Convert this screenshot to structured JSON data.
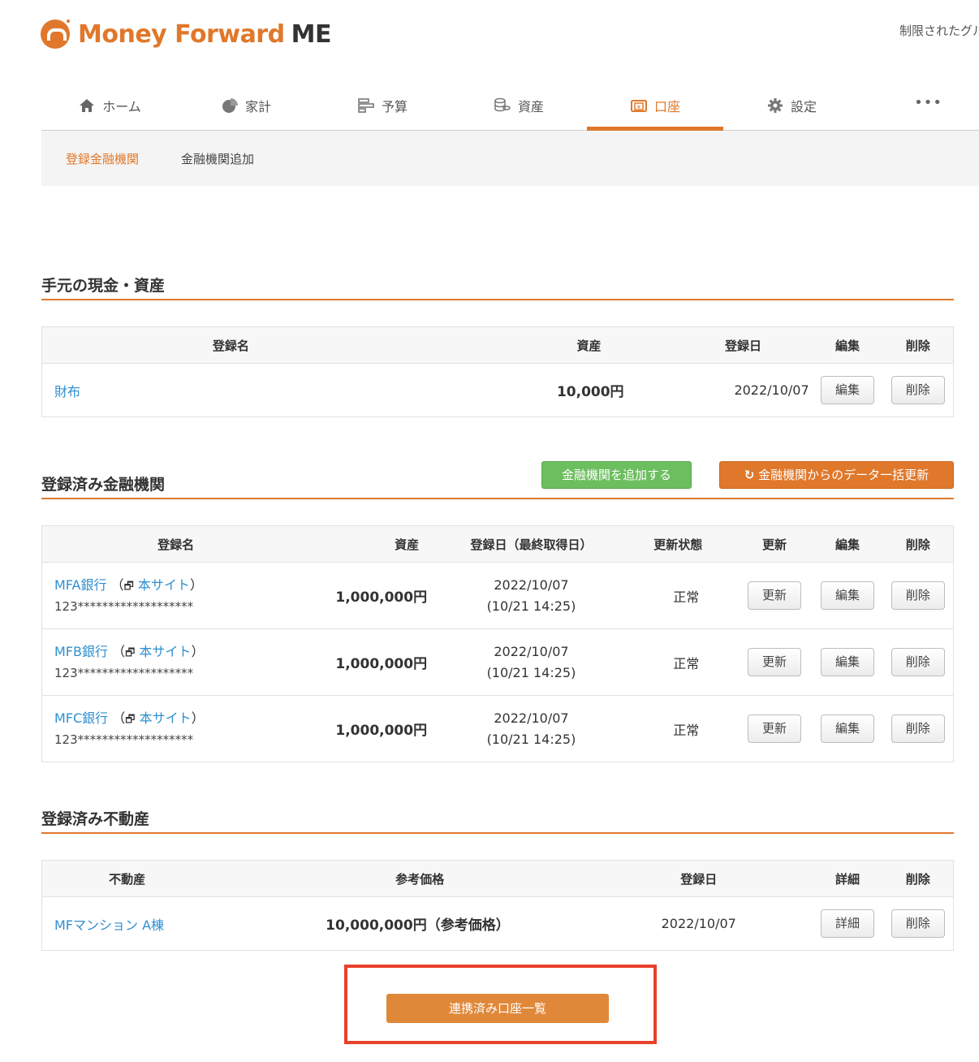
{
  "header": {
    "brand": "Money Forward",
    "brand_suffix": "ME",
    "user_text": "制限されたグル"
  },
  "nav": {
    "items": [
      {
        "label": "ホーム",
        "icon": "home-icon"
      },
      {
        "label": "家計",
        "icon": "pie-chart-icon"
      },
      {
        "label": "予算",
        "icon": "budget-bars-icon"
      },
      {
        "label": "資産",
        "icon": "coins-icon"
      },
      {
        "label": "口座",
        "icon": "wallet-icon",
        "active": true
      },
      {
        "label": "設定",
        "icon": "gear-icon"
      }
    ],
    "more": "•••"
  },
  "subnav": {
    "items": [
      "登録金融機関",
      "金融機関追加"
    ]
  },
  "cash_section": {
    "title": "手元の現金・資産",
    "headers": [
      "登録名",
      "資産",
      "登録日",
      "編集",
      "削除"
    ],
    "rows": [
      {
        "name": "財布",
        "amount": "10,000円",
        "date": "2022/10/07",
        "edit": "編集",
        "delete": "削除"
      }
    ]
  },
  "bank_section": {
    "title": "登録済み金融機関",
    "add_button": "金融機関を追加する",
    "refresh_button": "金融機関からのデータ一括更新",
    "headers": [
      "登録名",
      "資産",
      "登録日（最終取得日）",
      "更新状態",
      "更新",
      "編集",
      "削除"
    ],
    "rows": [
      {
        "name": "MFA銀行",
        "open_paren": "（",
        "site_link": "本サイト",
        "close_paren": "）",
        "number": "123*******************",
        "amount": "1,000,000円",
        "date": "2022/10/07",
        "last_fetch": "(10/21 14:25)",
        "status": "正常",
        "update": "更新",
        "edit": "編集",
        "delete": "削除"
      },
      {
        "name": "MFB銀行",
        "open_paren": "（",
        "site_link": "本サイト",
        "close_paren": "）",
        "number": "123*******************",
        "amount": "1,000,000円",
        "date": "2022/10/07",
        "last_fetch": "(10/21 14:25)",
        "status": "正常",
        "update": "更新",
        "edit": "編集",
        "delete": "削除"
      },
      {
        "name": "MFC銀行",
        "open_paren": "（",
        "site_link": "本サイト",
        "close_paren": "）",
        "number": "123*******************",
        "amount": "1,000,000円",
        "date": "2022/10/07",
        "last_fetch": "(10/21 14:25)",
        "status": "正常",
        "update": "更新",
        "edit": "編集",
        "delete": "削除"
      }
    ]
  },
  "realestate_section": {
    "title": "登録済み不動産",
    "headers": [
      "不動産",
      "参考価格",
      "登録日",
      "詳細",
      "削除"
    ],
    "rows": [
      {
        "name": "MFマンション A棟",
        "price": "10,000,000円（参考価格）",
        "date": "2022/10/07",
        "detail": "詳細",
        "delete": "削除"
      }
    ]
  },
  "footer": {
    "linked_accounts_button": "連携済み口座一覧"
  },
  "colors": {
    "accent": "#e0782b",
    "link": "#2f8fd0",
    "green": "#6cbe5e",
    "highlight": "#e8402a"
  }
}
